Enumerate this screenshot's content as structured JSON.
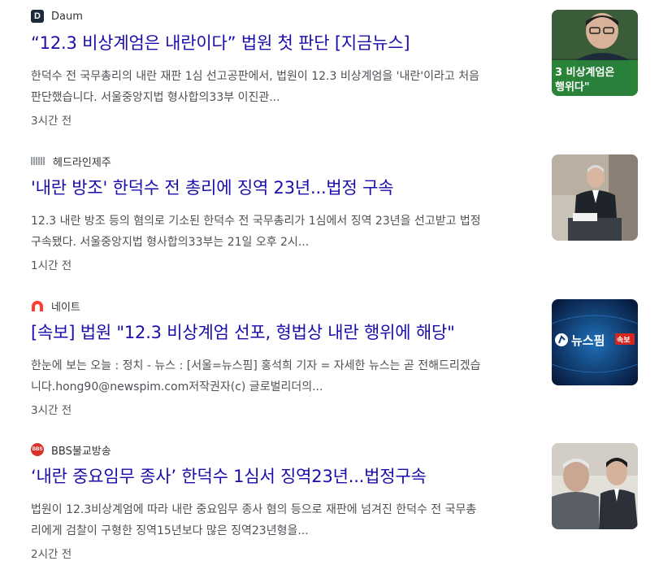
{
  "articles": [
    {
      "source": "Daum",
      "source_logo_text": "D",
      "headline": "“12.3 비상계엄은 내란이다” 법원 첫 판단 [지금뉴스]",
      "snippet_line1": "한덕수 전 국무총리의 내란 재판 1심 선고공판에서, 법원이 12.3 비상계엄을 '내란'이라고 처음",
      "snippet_line2": "판단했습니다. 서울중앙지법 형사합의33부 이진관...",
      "time": "3시간 전",
      "thumb_caption_line1": "3 비상계엄은",
      "thumb_caption_line2": "행위다\""
    },
    {
      "source": "헤드라인제주",
      "headline": "'내란 방조' 한덕수 전 총리에 징역 23년...법정 구속",
      "snippet_line1": "12.3 내란 방조 등의 혐의로 기소된 한덕수 전 국무총리가 1심에서 징역 23년을 선고받고 법정",
      "snippet_line2": "구속됐다. 서울중앙지법 형사합의33부는 21일 오후 2시...",
      "time": "1시간 전"
    },
    {
      "source": "네이트",
      "headline": "[속보] 법원 \"12.3 비상계엄 선포, 형법상 내란 행위에 해당\"",
      "snippet_line1": "한눈에 보는 오늘 : 정치 - 뉴스 : [서울=뉴스핌] 홍석희 기자 = 자세한 뉴스는 곧 전해드리겠습",
      "snippet_line2": "니다.hong90@newspim.com저작권자(c) 글로벌리더의...",
      "time": "3시간 전",
      "thumb_brand": "뉴스핌",
      "thumb_badge": "속보"
    },
    {
      "source": "BBS불교방송",
      "source_logo_text": "BBS",
      "headline": "‘내란 중요임무 종사’ 한덕수 1심서 징역23년...법정구속",
      "snippet_line1": "법원이 12.3비상계엄에 따라 내란 중요임무 종사 혐의 등으로 재판에 넘겨진 한덕수 전 국무총",
      "snippet_line2": "리에게 검찰이 구형한 징역15년보다 많은 징역23년형을...",
      "time": "2시간 전"
    }
  ],
  "colors": {
    "headline": "#1a0dab",
    "snippet": "#4d5156",
    "time": "#555555",
    "nate_brand": "#ff3d2e",
    "bbs_brand": "#d9322a",
    "daum_logo_bg": "#1e2a3a"
  },
  "icons": {
    "daum": "daum-logo-icon",
    "herald": "headline-jeju-logo-icon",
    "nate": "nate-logo-icon",
    "bbs": "bbs-logo-icon"
  }
}
